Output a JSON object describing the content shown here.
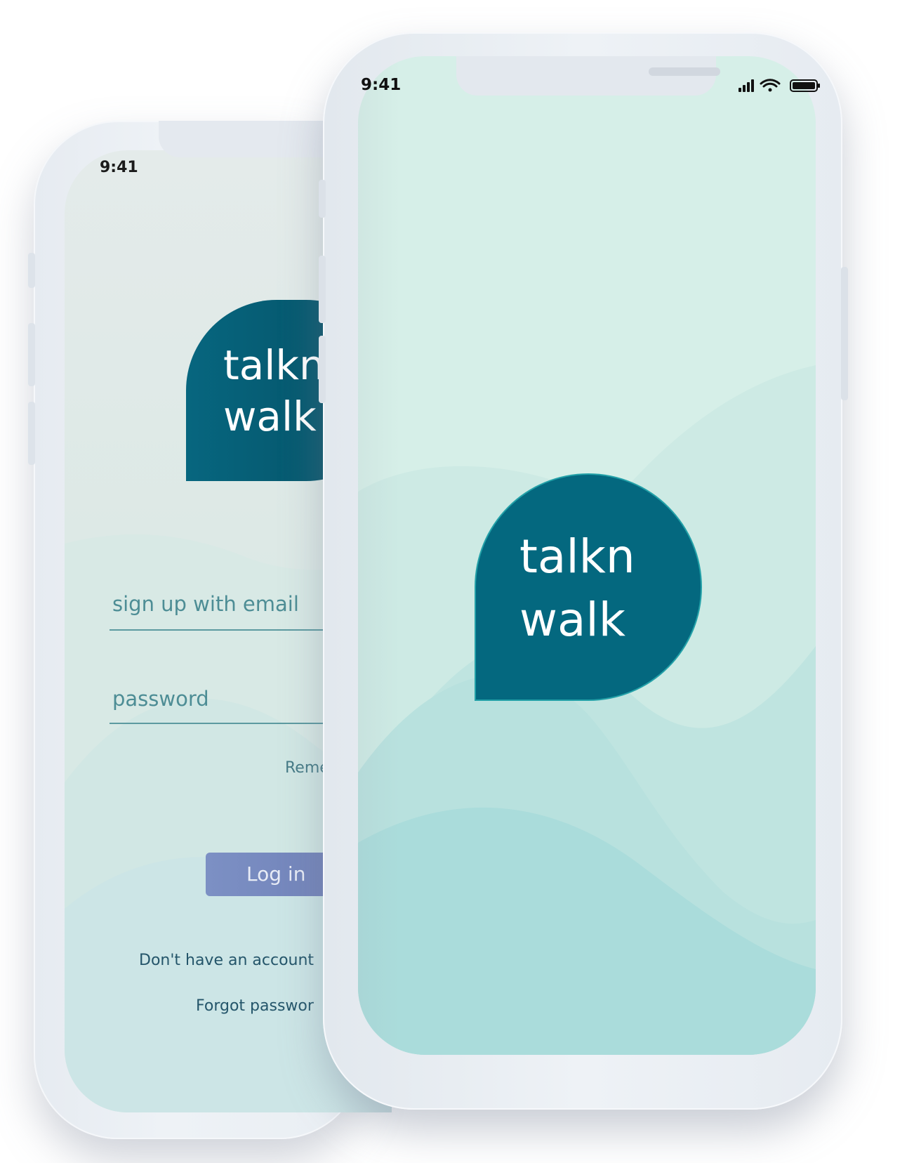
{
  "back_phone": {
    "status_time": "9:41",
    "logo_line1": "talkn",
    "logo_line2": "walk",
    "email_placeholder": "sign up with email",
    "password_placeholder": "password",
    "remember_label": "Reme",
    "login_button": "Log in",
    "signup_link": "Don't have an account",
    "forgot_link": "Forgot passwor"
  },
  "front_phone": {
    "status_time": "9:41",
    "logo_line1": "talkn",
    "logo_line2": "walk",
    "status_icons": [
      "signal-icon",
      "wifi-icon",
      "battery-icon"
    ]
  },
  "colors": {
    "brand_teal": "#04687f",
    "background_mint": "#d6efe8",
    "login_button": "#7585bd"
  }
}
